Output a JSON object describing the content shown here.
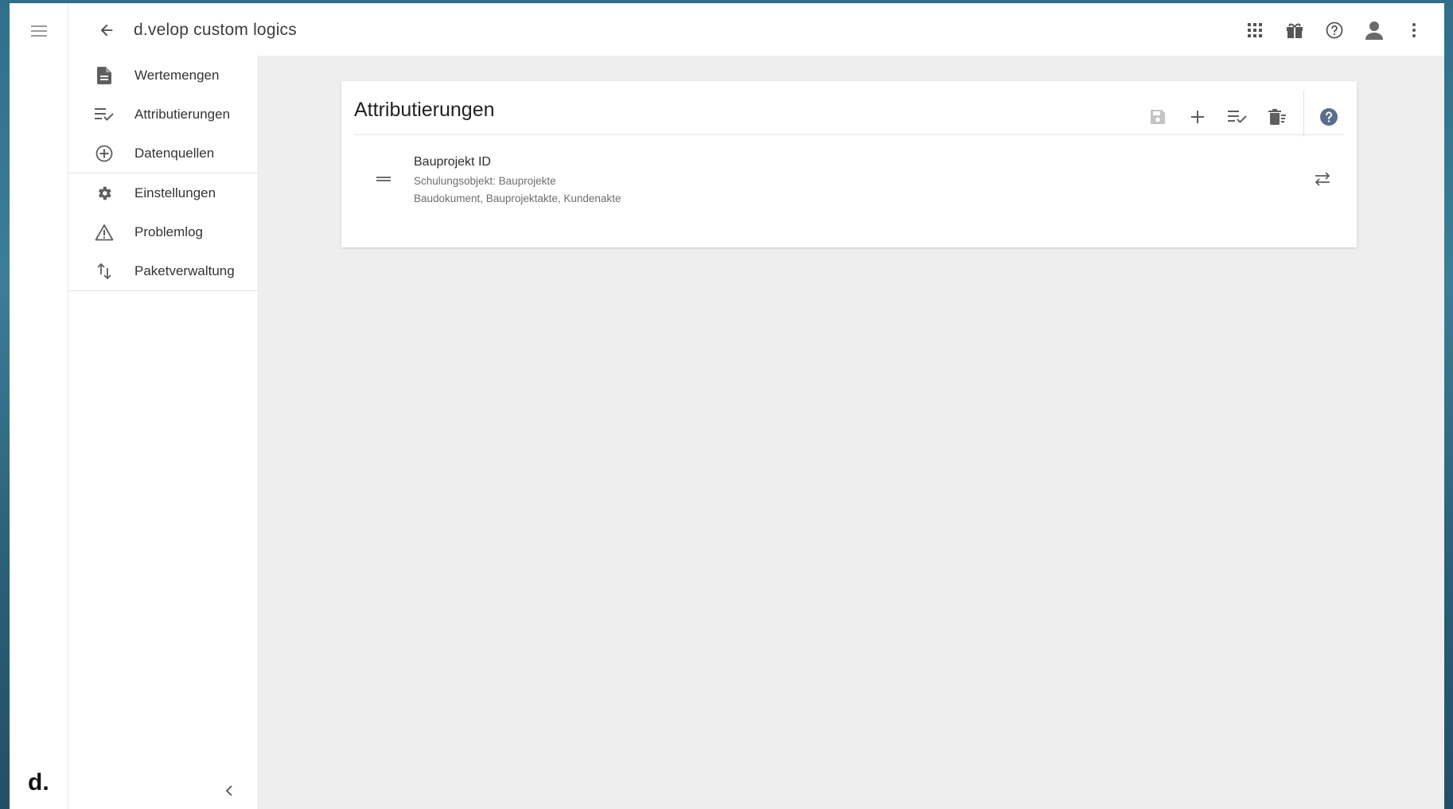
{
  "app": {
    "title": "d.velop custom logics",
    "logo": "d."
  },
  "icons": {
    "menu": "hamburger-menu-icon",
    "back": "arrow-back-icon",
    "apps": "apps-grid-icon",
    "gift": "gift-icon",
    "help": "help-circle-icon",
    "user": "user-avatar-icon",
    "more": "more-vert-icon"
  },
  "nav": {
    "items": [
      {
        "label": "Wertemengen",
        "icon": "document-icon"
      },
      {
        "label": "Attributierungen",
        "icon": "playlist-check-icon"
      },
      {
        "label": "Datenquellen",
        "icon": "add-circle-icon"
      },
      {
        "label": "Einstellungen",
        "icon": "gear-icon"
      },
      {
        "label": "Problemlog",
        "icon": "warning-icon"
      },
      {
        "label": "Paketverwaltung",
        "icon": "swap-vertical-icon"
      }
    ]
  },
  "card": {
    "title": "Attributierungen",
    "rows": [
      {
        "name": "Bauprojekt ID",
        "subtitle": "Schulungsobjekt: Bauprojekte",
        "categories": "Baudokument, Bauprojektakte, Kundenakte"
      }
    ]
  },
  "colors": {
    "icon": "#5f5f5f",
    "icon_disabled": "#c4c4c4",
    "help_accent": "#5b6d8c",
    "background": "#eeeeee"
  }
}
